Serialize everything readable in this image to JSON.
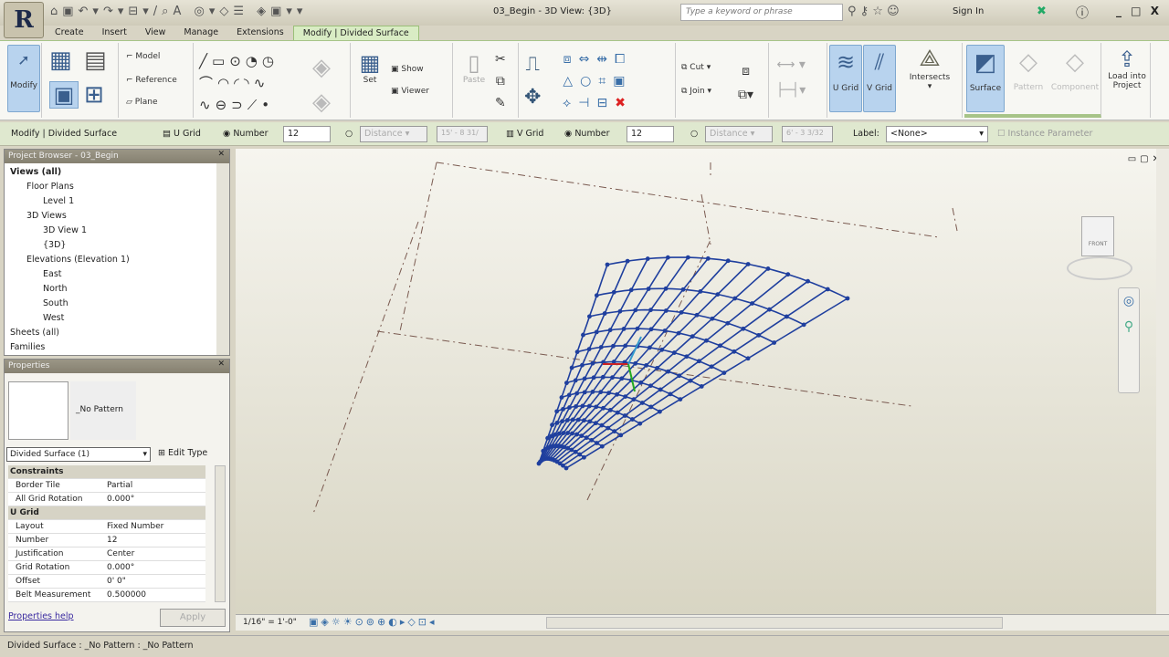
{
  "app": {
    "logo": "R",
    "title": "03_Begin - 3D View: {3D}",
    "search_placeholder": "Type a keyword or phrase",
    "sign_in": "Sign In",
    "window_controls": "_ □ X"
  },
  "tabs": [
    "Create",
    "Insert",
    "View",
    "Manage",
    "Extensions",
    "Modify | Divided Surface"
  ],
  "ribbon": {
    "modify": "Modify",
    "model": "Model",
    "reference": "Reference",
    "plane": "Plane",
    "set": "Set",
    "show": "Show",
    "viewer": "Viewer",
    "paste": "Paste",
    "cut": "Cut",
    "join": "Join",
    "u_grid": "U Grid",
    "v_grid": "V Grid",
    "intersects": "Intersects",
    "surface": "Surface",
    "pattern": "Pattern",
    "component": "Component",
    "load_into_project": "Load into Project"
  },
  "options": {
    "context": "Modify | Divided Surface",
    "u_grid": "U Grid",
    "u_number_label": "Number",
    "u_number": "12",
    "u_distance": "Distance",
    "u_distance_value": "15' - 8 31/",
    "v_grid": "V Grid",
    "v_number_label": "Number",
    "v_number": "12",
    "v_distance": "Distance",
    "v_distance_value": "6' - 3 3/32",
    "label_label": "Label:",
    "label_value": "<None>",
    "instance_param": "Instance Parameter"
  },
  "browser": {
    "title": "Project Browser - 03_Begin",
    "nodes": [
      "Views (all)",
      "Floor Plans",
      "Level 1",
      "3D Views",
      "3D View 1",
      "{3D}",
      "Elevations (Elevation 1)",
      "East",
      "North",
      "South",
      "West",
      "Sheets (all)",
      "Families"
    ]
  },
  "properties": {
    "title": "Properties",
    "type_name": "_No Pattern",
    "selector": "Divided Surface (1)",
    "edit_type": "Edit Type",
    "rows": [
      {
        "group": "Constraints"
      },
      {
        "k": "Border Tile",
        "v": "Partial"
      },
      {
        "k": "All Grid Rotation",
        "v": "0.000°"
      },
      {
        "group": "U Grid"
      },
      {
        "k": "Layout",
        "v": "Fixed Number"
      },
      {
        "k": "Number",
        "v": "12"
      },
      {
        "k": "Justification",
        "v": "Center"
      },
      {
        "k": "Grid Rotation",
        "v": "0.000°"
      },
      {
        "k": "Offset",
        "v": "0' 0\""
      },
      {
        "k": "Belt Measurement",
        "v": "0.500000"
      }
    ],
    "help": "Properties help",
    "apply": "Apply"
  },
  "viewbar": {
    "scale": "1/16\" = 1'-0\""
  },
  "status": "Divided Surface : _No Pattern : _No Pattern",
  "colors": {
    "grid": "#1f3f9e",
    "accent": "#d9ecc4"
  }
}
